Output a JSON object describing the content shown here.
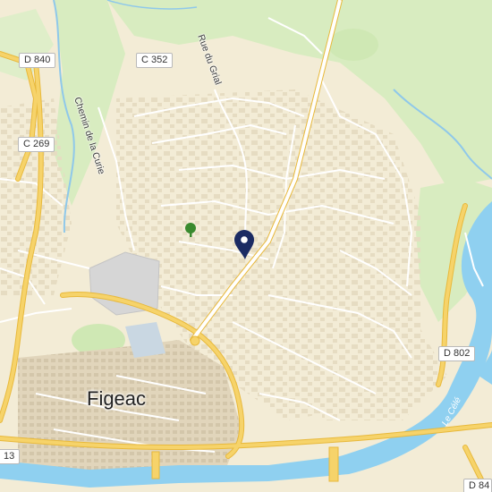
{
  "map": {
    "place_label": "Figeac",
    "river_label": "Le Célé",
    "road_shields": [
      "D 840",
      "C 352",
      "C 269",
      "D 802",
      "13",
      "D 84"
    ],
    "street_labels": [
      "Rue du Grial",
      "Chemin de la Curie"
    ],
    "marker_icon": "location-pin-icon",
    "park_icon": "tree-icon",
    "colors": {
      "land": "#f3ecd6",
      "vegetation": "#d8ecc0",
      "water": "#8fd0f0",
      "major_road": "#f6d36a",
      "minor_road": "#ffffff",
      "marker": "#1b2b63"
    }
  }
}
